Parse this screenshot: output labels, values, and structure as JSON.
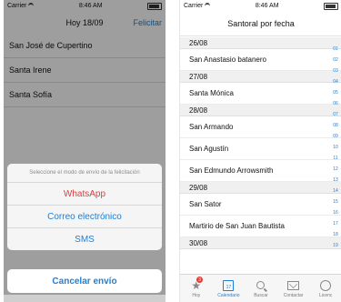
{
  "left": {
    "status": {
      "carrier": "Carrier",
      "time": "8:46 AM"
    },
    "nav": {
      "title": "Hoy 18/09",
      "right": "Felicitar"
    },
    "saints": [
      "San José de Cupertino",
      "Santa Irene",
      "Santa Sofía"
    ],
    "sheet": {
      "message": "Seleccione el modo de envío de la felicitación",
      "options": [
        "WhatsApp",
        "Correo electrónico",
        "SMS"
      ],
      "cancel": "Cancelar envío"
    }
  },
  "right": {
    "status": {
      "carrier": "Carrier",
      "time": "8:46 AM"
    },
    "nav": {
      "title": "Santoral por fecha"
    },
    "sections": [
      {
        "date": "26/08",
        "items": [
          "San Anastasio batanero"
        ]
      },
      {
        "date": "27/08",
        "items": [
          "Santa Mónica"
        ]
      },
      {
        "date": "28/08",
        "items": [
          "San Armando",
          "San Agustín",
          "San Edmundo Arrowsmith"
        ]
      },
      {
        "date": "29/08",
        "items": [
          "San Sator",
          "Martirio de San Juan Bautista"
        ]
      },
      {
        "date": "30/08",
        "items": []
      }
    ],
    "index": [
      "01",
      "02",
      "03",
      "04",
      "05",
      "06",
      "07",
      "08",
      "09",
      "10",
      "11",
      "12",
      "13",
      "14",
      "15",
      "16",
      "17",
      "18",
      "19"
    ],
    "tabs": [
      {
        "label": "Hoy",
        "badge": "3",
        "icon": "star-icon"
      },
      {
        "label": "Calendario",
        "icon": "calendar-icon",
        "day": "17"
      },
      {
        "label": "Buscar",
        "icon": "search-icon"
      },
      {
        "label": "Contactar",
        "icon": "mail-icon"
      },
      {
        "label": "Licenc",
        "icon": "license-icon"
      }
    ],
    "accent": "#1e7fd6"
  }
}
